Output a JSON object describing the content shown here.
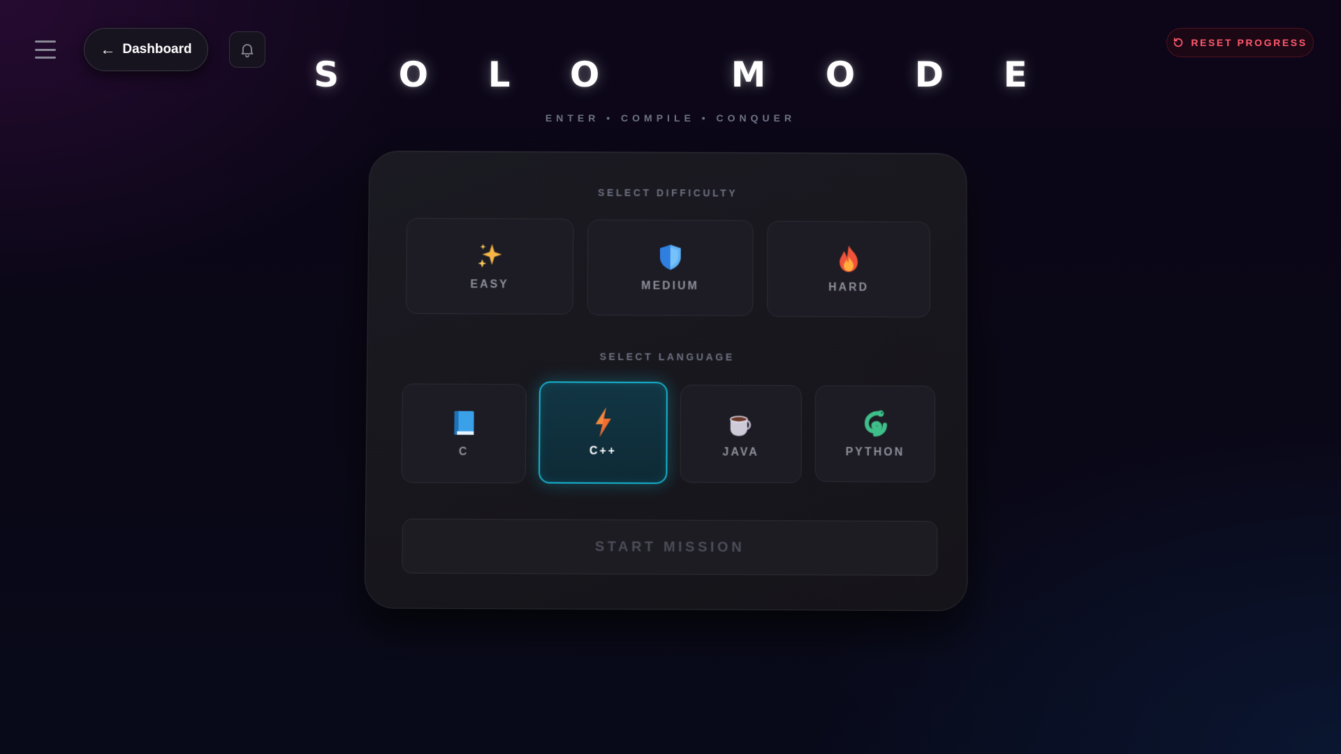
{
  "header": {
    "back_button_label": "Dashboard",
    "reset_button_label": "RESET PROGRESS"
  },
  "hero": {
    "title": "S O L O   M O D E",
    "subtitle": "ENTER • COMPILE • CONQUER"
  },
  "difficulty": {
    "section_label": "SELECT DIFFICULTY",
    "options": [
      {
        "label": "EASY",
        "icon": "sparkles-icon"
      },
      {
        "label": "MEDIUM",
        "icon": "shield-icon"
      },
      {
        "label": "HARD",
        "icon": "fire-icon"
      }
    ],
    "selected": null
  },
  "language": {
    "section_label": "SELECT LANGUAGE",
    "options": [
      {
        "label": "C",
        "icon": "book-icon"
      },
      {
        "label": "C++",
        "icon": "lightning-icon"
      },
      {
        "label": "JAVA",
        "icon": "coffee-icon"
      },
      {
        "label": "PYTHON",
        "icon": "snake-icon"
      }
    ],
    "selected": "C++"
  },
  "start_button_label": "START MISSION",
  "colors": {
    "accent": "#17b6d2",
    "danger": "#ff5a6e",
    "card_bg": "#1b1a22"
  }
}
